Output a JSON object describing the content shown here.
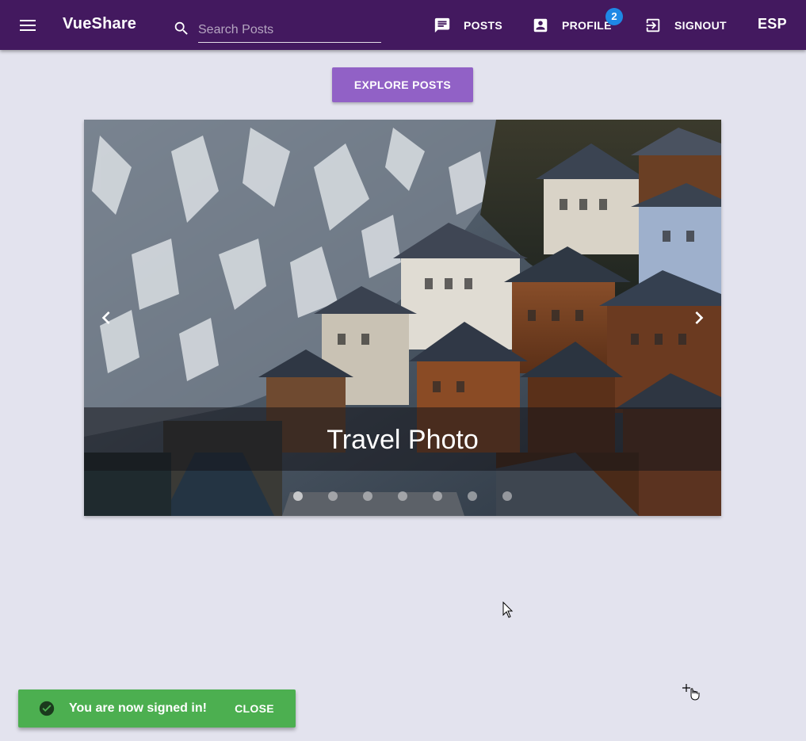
{
  "toolbar": {
    "app_title": "VueShare",
    "search_placeholder": "Search Posts",
    "posts_label": "POSTS",
    "profile_label": "PROFILE",
    "profile_badge": "2",
    "signout_label": "SIGNOUT",
    "language_label": "ESP"
  },
  "main": {
    "explore_label": "EXPLORE POSTS"
  },
  "carousel": {
    "caption": "Travel Photo",
    "slide_count": 7,
    "active_index": 0
  },
  "snackbar": {
    "message": "You are now signed in!",
    "close_label": "CLOSE"
  },
  "colors": {
    "toolbar": "#43195f",
    "accent_button": "#9161c6",
    "badge": "#1e88e5",
    "snackbar": "#4caf50",
    "background": "#e3e3ee"
  }
}
